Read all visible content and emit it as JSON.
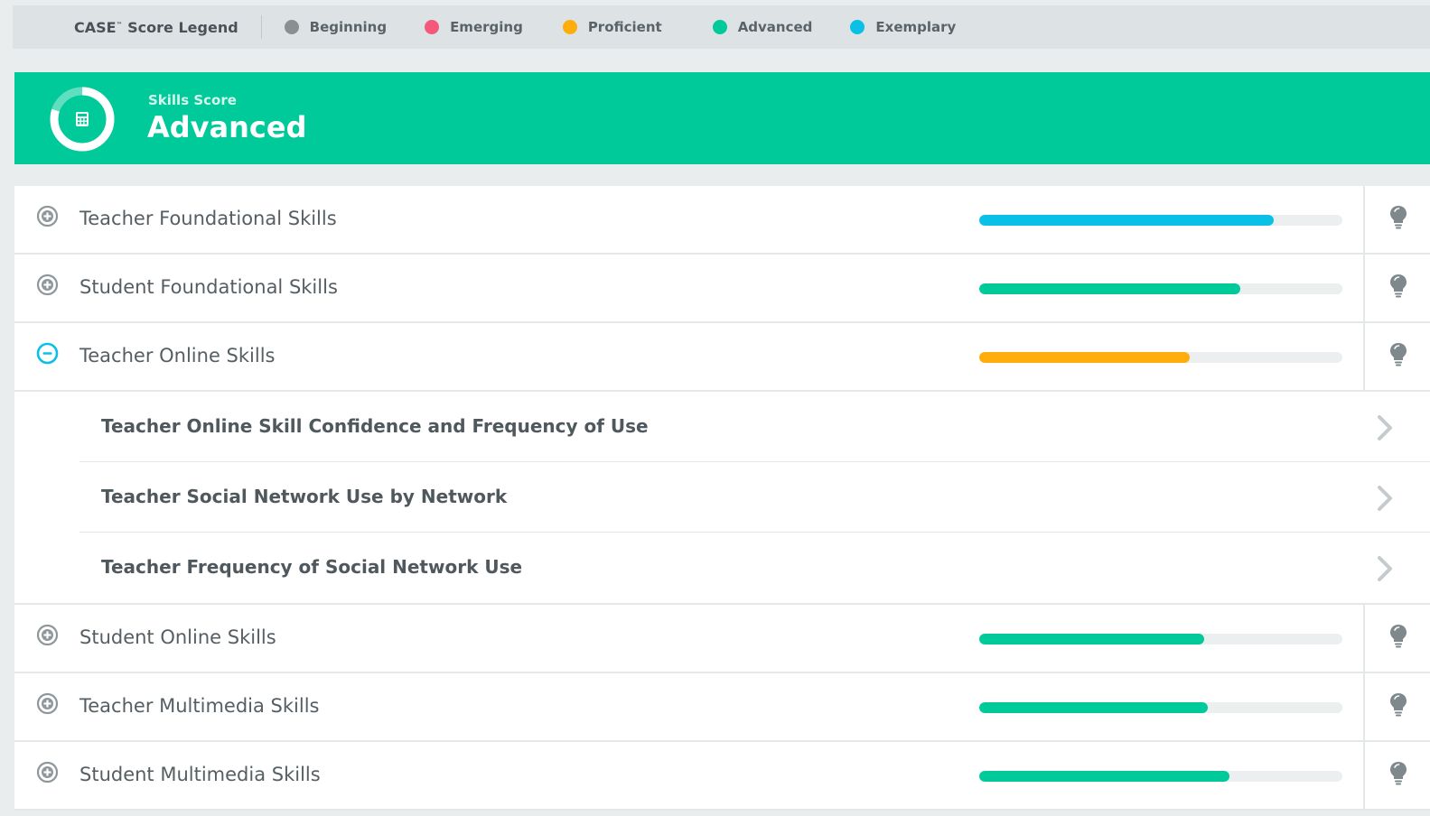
{
  "legend": {
    "title": "CASE",
    "title_mark": "™",
    "title_suffix": " Score Legend",
    "items": [
      {
        "label": "Beginning",
        "color": "#8a8f92"
      },
      {
        "label": "Emerging",
        "color": "#f4587a"
      },
      {
        "label": "Proficient",
        "color": "#ffad0d"
      },
      {
        "label": "Advanced",
        "color": "#00c99a"
      },
      {
        "label": "Exemplary",
        "color": "#0ac0e6"
      }
    ]
  },
  "banner": {
    "subtitle": "Skills Score",
    "score": "Advanced",
    "icon": "calculator-icon",
    "donut_fraction": 0.8
  },
  "skills": [
    {
      "label": "Teacher Foundational Skills",
      "progress": 0.81,
      "color": "#0ac0e6",
      "expanded": false
    },
    {
      "label": "Student Foundational Skills",
      "progress": 0.72,
      "color": "#00c99a",
      "expanded": false
    },
    {
      "label": "Teacher Online Skills",
      "progress": 0.58,
      "color": "#ffad0d",
      "expanded": true,
      "children": [
        "Teacher Online Skill Confidence and Frequency of Use",
        "Teacher Social Network Use by Network",
        "Teacher Frequency of Social Network Use"
      ]
    },
    {
      "label": "Student Online Skills",
      "progress": 0.62,
      "color": "#00c99a",
      "expanded": false
    },
    {
      "label": "Teacher Multimedia Skills",
      "progress": 0.63,
      "color": "#00c99a",
      "expanded": false
    },
    {
      "label": "Student Multimedia Skills",
      "progress": 0.69,
      "color": "#00c99a",
      "expanded": false
    }
  ]
}
